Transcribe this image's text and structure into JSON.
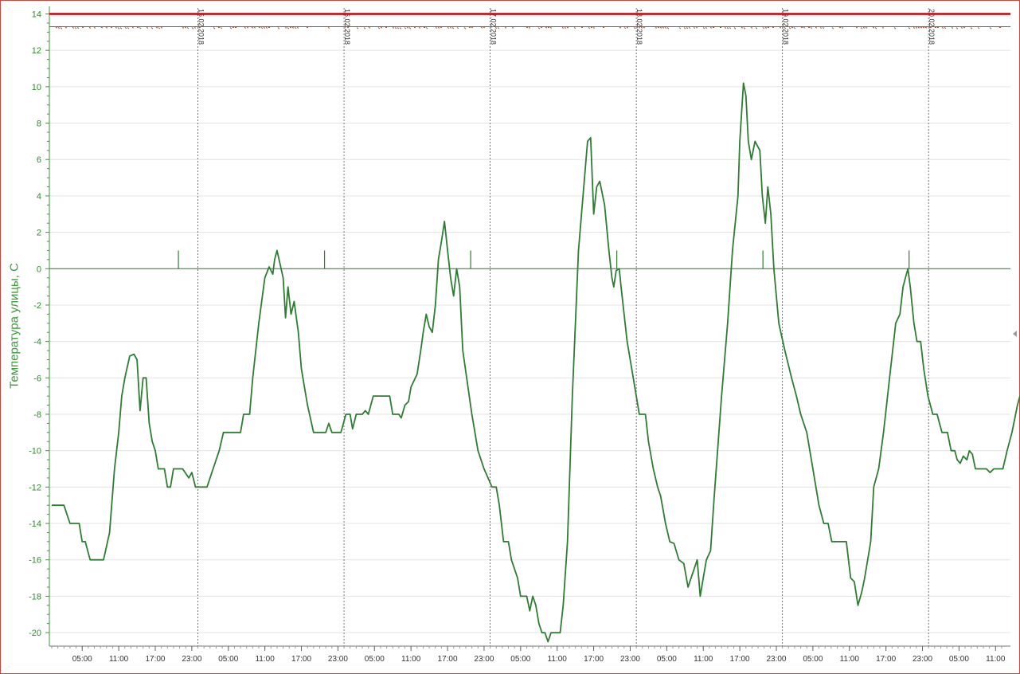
{
  "colors": {
    "temperature_line": "#2e7d32",
    "axis_green": "#3a9a3a",
    "setpoint_red": "#cc0000",
    "brown_trace": "#a0522d",
    "grid": "#e3e3e3",
    "day_divider": "#555555",
    "frame": "#d0453c"
  },
  "chart_data": {
    "type": "line",
    "ylabel": "Температура улицы, С",
    "ylim": [
      -20.7,
      14.4
    ],
    "yticks": [
      14,
      12,
      10,
      8,
      6,
      4,
      2,
      0,
      -2,
      -4,
      -6,
      -8,
      -10,
      -12,
      -14,
      -16,
      -18,
      -20
    ],
    "xlim_hours": [
      0,
      156
    ],
    "xticks": [
      {
        "h": 5,
        "label": "05:00"
      },
      {
        "h": 11,
        "label": "11:00"
      },
      {
        "h": 17,
        "label": "17:00"
      },
      {
        "h": 23,
        "label": "23:00"
      },
      {
        "h": 29,
        "label": "05:00"
      },
      {
        "h": 35,
        "label": "11:00"
      },
      {
        "h": 41,
        "label": "17:00"
      },
      {
        "h": 47,
        "label": "23:00"
      },
      {
        "h": 53,
        "label": "05:00"
      },
      {
        "h": 59,
        "label": "11:00"
      },
      {
        "h": 65,
        "label": "17:00"
      },
      {
        "h": 71,
        "label": "23:00"
      },
      {
        "h": 77,
        "label": "05:00"
      },
      {
        "h": 83,
        "label": "11:00"
      },
      {
        "h": 89,
        "label": "17:00"
      },
      {
        "h": 95,
        "label": "23:00"
      },
      {
        "h": 101,
        "label": "05:00"
      },
      {
        "h": 107,
        "label": "11:00"
      },
      {
        "h": 113,
        "label": "17:00"
      },
      {
        "h": 119,
        "label": "23:00"
      },
      {
        "h": 125,
        "label": "05:00"
      },
      {
        "h": 131,
        "label": "11:00"
      },
      {
        "h": 137,
        "label": "17:00"
      },
      {
        "h": 143,
        "label": "23:00"
      },
      {
        "h": 149,
        "label": "05:00"
      },
      {
        "h": 155,
        "label": "11:00"
      }
    ],
    "day_dividers": [
      {
        "h": 24,
        "label": "15.02.2018"
      },
      {
        "h": 48,
        "label": "16.02.2018"
      },
      {
        "h": 72,
        "label": "17.02.2018"
      },
      {
        "h": 96,
        "label": "18.02.2018"
      },
      {
        "h": 120,
        "label": "19.02.2018"
      },
      {
        "h": 144,
        "label": "20.02.2018"
      }
    ],
    "reference_lines": [
      {
        "y": 14,
        "color": "#cc0000"
      },
      {
        "y": 0,
        "color": "#2e7d32"
      }
    ],
    "markers_at_zero": [
      20.8,
      44.8,
      68.8,
      92.8,
      116.8,
      140.8
    ],
    "series": [
      {
        "color": "#2e7d32",
        "points": [
          [
            0,
            -13
          ],
          [
            2,
            -13
          ],
          [
            3,
            -14
          ],
          [
            4.5,
            -14
          ],
          [
            5,
            -15
          ],
          [
            5.5,
            -15
          ],
          [
            6.3,
            -16
          ],
          [
            8.5,
            -16
          ],
          [
            9.5,
            -14.5
          ],
          [
            10.3,
            -11
          ],
          [
            11,
            -9
          ],
          [
            11.5,
            -7
          ],
          [
            12,
            -6
          ],
          [
            12.8,
            -4.8
          ],
          [
            13.5,
            -4.7
          ],
          [
            14,
            -5
          ],
          [
            14.5,
            -7.8
          ],
          [
            15,
            -6
          ],
          [
            15.5,
            -6
          ],
          [
            16,
            -8.5
          ],
          [
            16.5,
            -9.5
          ],
          [
            17,
            -10
          ],
          [
            17.5,
            -11
          ],
          [
            18.5,
            -11
          ],
          [
            19,
            -12
          ],
          [
            19.5,
            -12
          ],
          [
            20,
            -11
          ],
          [
            21.5,
            -11
          ],
          [
            22.5,
            -11.5
          ],
          [
            23,
            -11.2
          ],
          [
            23.6,
            -12
          ],
          [
            25.5,
            -12
          ],
          [
            26.5,
            -11
          ],
          [
            27.5,
            -10
          ],
          [
            28.2,
            -9
          ],
          [
            31,
            -9
          ],
          [
            31.5,
            -8
          ],
          [
            32.5,
            -8
          ],
          [
            33,
            -6
          ],
          [
            34,
            -3
          ],
          [
            35,
            -0.5
          ],
          [
            35.7,
            0.1
          ],
          [
            36.3,
            -0.3
          ],
          [
            36.6,
            0.5
          ],
          [
            37,
            1
          ],
          [
            38,
            -0.5
          ],
          [
            38.4,
            -2.7
          ],
          [
            38.8,
            -1
          ],
          [
            39.3,
            -2.5
          ],
          [
            39.8,
            -1.8
          ],
          [
            40.5,
            -3.5
          ],
          [
            41,
            -5.5
          ],
          [
            42,
            -7.5
          ],
          [
            43,
            -9
          ],
          [
            45,
            -9
          ],
          [
            45.5,
            -8.5
          ],
          [
            46,
            -9
          ],
          [
            47.5,
            -9
          ],
          [
            48.3,
            -8
          ],
          [
            49,
            -8
          ],
          [
            49.4,
            -8.8
          ],
          [
            50,
            -8
          ],
          [
            51,
            -8
          ],
          [
            51.5,
            -7.8
          ],
          [
            52,
            -8
          ],
          [
            52.8,
            -7
          ],
          [
            55.5,
            -7
          ],
          [
            56,
            -8
          ],
          [
            57,
            -8
          ],
          [
            57.4,
            -8.2
          ],
          [
            58,
            -7.5
          ],
          [
            58.6,
            -7.3
          ],
          [
            59,
            -6.5
          ],
          [
            60,
            -5.8
          ],
          [
            60.6,
            -4.5
          ],
          [
            61,
            -3.5
          ],
          [
            61.5,
            -2.5
          ],
          [
            62,
            -3.2
          ],
          [
            62.5,
            -3.5
          ],
          [
            63,
            -2
          ],
          [
            63.5,
            0.5
          ],
          [
            64,
            1.5
          ],
          [
            64.5,
            2.6
          ],
          [
            65,
            1
          ],
          [
            65.5,
            -0.5
          ],
          [
            66,
            -1.5
          ],
          [
            66.5,
            0
          ],
          [
            67,
            -1
          ],
          [
            67.5,
            -4.5
          ],
          [
            69,
            -8
          ],
          [
            70,
            -10
          ],
          [
            71,
            -11
          ],
          [
            72.3,
            -12
          ],
          [
            73,
            -12
          ],
          [
            73.5,
            -13
          ],
          [
            74.2,
            -15
          ],
          [
            75,
            -15
          ],
          [
            75.5,
            -16
          ],
          [
            76.5,
            -17
          ],
          [
            77,
            -18
          ],
          [
            78,
            -18
          ],
          [
            78.5,
            -18.8
          ],
          [
            79,
            -18
          ],
          [
            79.5,
            -18.5
          ],
          [
            80,
            -19.5
          ],
          [
            80.5,
            -20
          ],
          [
            81,
            -20
          ],
          [
            81.5,
            -20.5
          ],
          [
            82,
            -20
          ],
          [
            83.5,
            -20
          ],
          [
            84,
            -18.5
          ],
          [
            84.7,
            -15
          ],
          [
            85.5,
            -7
          ],
          [
            86.5,
            1
          ],
          [
            87.5,
            5
          ],
          [
            88,
            7
          ],
          [
            88.5,
            7.2
          ],
          [
            89,
            3
          ],
          [
            89.5,
            4.5
          ],
          [
            90,
            4.8
          ],
          [
            90.8,
            3.5
          ],
          [
            91.5,
            1
          ],
          [
            92,
            -0.5
          ],
          [
            92.3,
            -1
          ],
          [
            92.7,
            -0.1
          ],
          [
            93.2,
            0
          ],
          [
            93.5,
            -1
          ],
          [
            94.5,
            -4
          ],
          [
            95.5,
            -6
          ],
          [
            96.5,
            -8
          ],
          [
            97.5,
            -8
          ],
          [
            98,
            -9.5
          ],
          [
            98.8,
            -11
          ],
          [
            99.5,
            -12
          ],
          [
            100,
            -12.5
          ],
          [
            100.8,
            -14
          ],
          [
            101.5,
            -15
          ],
          [
            102.2,
            -15.1
          ],
          [
            103,
            -16
          ],
          [
            103.8,
            -16.2
          ],
          [
            104.5,
            -17.5
          ],
          [
            105,
            -17
          ],
          [
            105.5,
            -16.5
          ],
          [
            106,
            -16
          ],
          [
            106.5,
            -18
          ],
          [
            107,
            -17
          ],
          [
            107.5,
            -16
          ],
          [
            108.2,
            -15.5
          ],
          [
            108.8,
            -12.5
          ],
          [
            110,
            -7
          ],
          [
            111,
            -3
          ],
          [
            111.8,
            1
          ],
          [
            112.7,
            4
          ],
          [
            113,
            7
          ],
          [
            113.6,
            10.2
          ],
          [
            114,
            9.5
          ],
          [
            114.4,
            7
          ],
          [
            114.9,
            6
          ],
          [
            115.5,
            7
          ],
          [
            116.3,
            6.5
          ],
          [
            116.7,
            4
          ],
          [
            117.2,
            2.5
          ],
          [
            117.6,
            4.5
          ],
          [
            118.1,
            3
          ],
          [
            118.6,
            0
          ],
          [
            119.4,
            -3
          ],
          [
            120.4,
            -4.5
          ],
          [
            121.5,
            -6
          ],
          [
            122.3,
            -7
          ],
          [
            123,
            -8
          ],
          [
            124,
            -9
          ],
          [
            125,
            -11
          ],
          [
            126,
            -13
          ],
          [
            126.8,
            -14
          ],
          [
            127.5,
            -14
          ],
          [
            128.1,
            -15
          ],
          [
            128.7,
            -15
          ],
          [
            130.5,
            -15
          ],
          [
            131.2,
            -17
          ],
          [
            131.8,
            -17.2
          ],
          [
            132.4,
            -18.5
          ],
          [
            133,
            -17.8
          ],
          [
            133.5,
            -17
          ],
          [
            134.5,
            -15
          ],
          [
            135,
            -12
          ],
          [
            135.8,
            -11
          ],
          [
            136.6,
            -9
          ],
          [
            137.6,
            -6
          ],
          [
            138.6,
            -3
          ],
          [
            139.3,
            -2.5
          ],
          [
            139.8,
            -1
          ],
          [
            140.2,
            -0.5
          ],
          [
            140.6,
            0
          ],
          [
            141,
            -1
          ],
          [
            141.6,
            -3
          ],
          [
            142.1,
            -4
          ],
          [
            142.7,
            -4
          ],
          [
            143.2,
            -5.5
          ],
          [
            143.9,
            -7
          ],
          [
            144.7,
            -8
          ],
          [
            145.4,
            -8
          ],
          [
            146.2,
            -9
          ],
          [
            147.1,
            -9
          ],
          [
            147.7,
            -10
          ],
          [
            148.3,
            -10
          ],
          [
            148.7,
            -10.5
          ],
          [
            149.2,
            -10.7
          ],
          [
            149.7,
            -10.3
          ],
          [
            150.3,
            -10.5
          ],
          [
            150.7,
            -10
          ],
          [
            151.2,
            -10.2
          ],
          [
            151.7,
            -11
          ],
          [
            152.5,
            -11
          ],
          [
            153.5,
            -11
          ],
          [
            154.1,
            -11.2
          ],
          [
            154.7,
            -11
          ],
          [
            155.5,
            -11
          ],
          [
            156.2,
            -11
          ],
          [
            156.9,
            -10
          ],
          [
            157.7,
            -9
          ],
          [
            158,
            -8.5
          ],
          [
            158.6,
            -7.5
          ],
          [
            159,
            -7
          ],
          [
            159.4,
            -7.3
          ]
        ]
      }
    ]
  }
}
